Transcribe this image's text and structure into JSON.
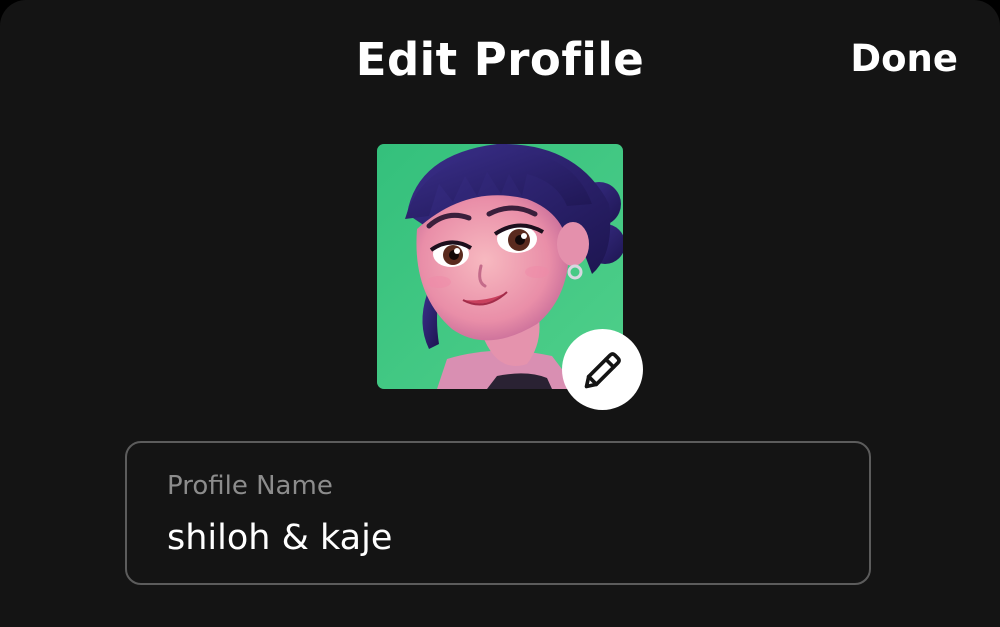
{
  "header": {
    "title": "Edit Profile",
    "done_label": "Done"
  },
  "avatar": {
    "icon": "pencil-icon",
    "background_color": "#3dbf79"
  },
  "profile_name_field": {
    "label": "Profile Name",
    "value": "shiloh & kaje"
  },
  "colors": {
    "background": "#141414",
    "text": "#ffffff",
    "label": "#8c8c8c",
    "field_border": "#5c5c5c"
  }
}
